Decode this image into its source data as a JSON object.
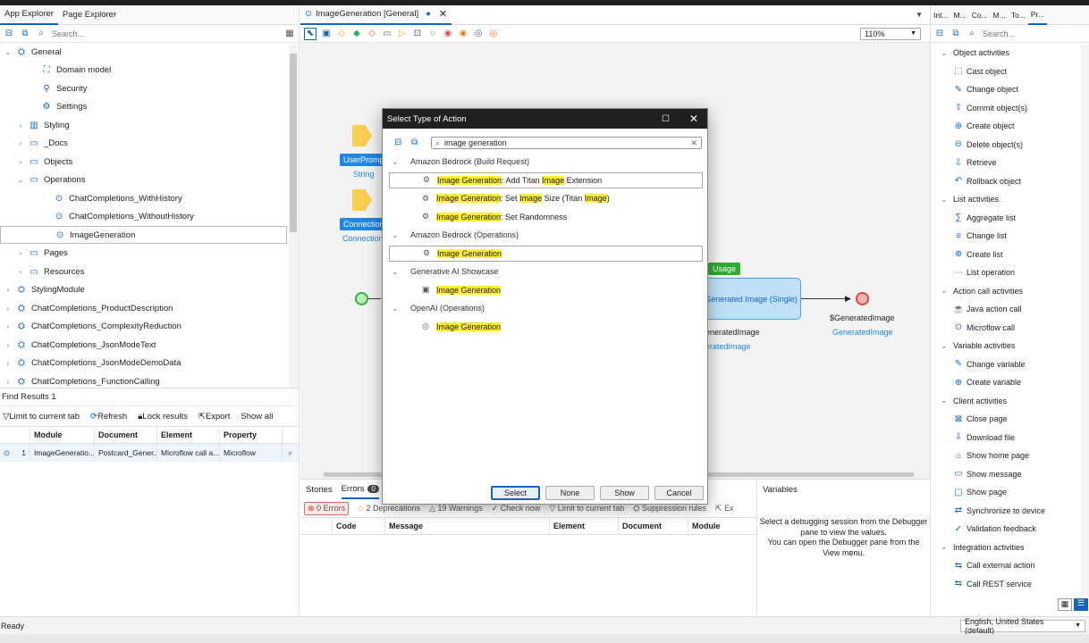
{
  "left_tabs": [
    "App Explorer",
    "Page Explorer"
  ],
  "search_placeholder": "Search...",
  "tree": [
    {
      "label": "General",
      "chev": "v",
      "icon": "module-icon",
      "indent": 0
    },
    {
      "label": "Domain model",
      "chev": "",
      "icon": "domain-model-icon",
      "indent": 2
    },
    {
      "label": "Security",
      "chev": "",
      "icon": "security-icon",
      "indent": 2
    },
    {
      "label": "Settings",
      "chev": "",
      "icon": "settings-icon",
      "indent": 2
    },
    {
      "label": "Styling",
      "chev": ">",
      "icon": "styling-icon",
      "indent": 1
    },
    {
      "label": "_Docs",
      "chev": ">",
      "icon": "folder-icon",
      "indent": 1
    },
    {
      "label": "Objects",
      "chev": ">",
      "icon": "folder-icon",
      "indent": 1
    },
    {
      "label": "Operations",
      "chev": "v",
      "icon": "folder-icon",
      "indent": 1
    },
    {
      "label": "ChatCompletions_WithHistory",
      "chev": "",
      "icon": "microflow-icon",
      "indent": 3
    },
    {
      "label": "ChatCompletions_WithoutHistory",
      "chev": "",
      "icon": "microflow-icon",
      "indent": 3
    },
    {
      "label": "ImageGeneration",
      "chev": "",
      "icon": "microflow-icon",
      "indent": 3
    },
    {
      "label": "Pages",
      "chev": ">",
      "icon": "folder-icon",
      "indent": 1
    },
    {
      "label": "Resources",
      "chev": ">",
      "icon": "folder-icon",
      "indent": 1
    },
    {
      "label": "StylingModule",
      "chev": ">",
      "icon": "module-icon",
      "indent": 0
    },
    {
      "label": "ChatCompletions_ProductDescription",
      "chev": ">",
      "icon": "module-icon",
      "indent": 0
    },
    {
      "label": "ChatCompletions_ComplexityReduction",
      "chev": ">",
      "icon": "module-icon",
      "indent": 0
    },
    {
      "label": "ChatCompletions_JsonModeText",
      "chev": ">",
      "icon": "module-icon",
      "indent": 0
    },
    {
      "label": "ChatCompletions_JsonModeDemoData",
      "chev": ">",
      "icon": "module-icon",
      "indent": 0
    },
    {
      "label": "ChatCompletions_FunctionCalling",
      "chev": ">",
      "icon": "module-icon",
      "indent": 0
    }
  ],
  "find": {
    "title": "Find Results 1",
    "tools": [
      "Limit to current tab",
      "Refresh",
      "Lock results",
      "Export",
      "Show all"
    ],
    "columns": [
      "Module",
      "Document",
      "Element",
      "Property"
    ],
    "row": {
      "num": "1",
      "module": "ImageGeneratio...",
      "document": "Postcard_Gener...",
      "element": "Microflow call a...",
      "property": "Microflow"
    }
  },
  "editor": {
    "tab_label": "ImageGeneration [General]",
    "zoom": "110%",
    "nodes": {
      "user_prompt_label": "UserPromp",
      "user_prompt_type": "String",
      "connection_label": "Connection",
      "connection_type": "Connection",
      "usage_badge": "Usage",
      "generated_single": "Generated Image (Single)",
      "generated_var_partial": "eneratedImage",
      "generated_type_partial": "eratedImage",
      "generated_var": "$GeneratedImage",
      "generated_type": "GeneratedImage"
    }
  },
  "dialog": {
    "title": "Select Type of Action",
    "search_value": "image generation",
    "groups": [
      {
        "label": "Amazon Bedrock (Build Request)",
        "items": [
          {
            "parts": [
              [
                "Image Generation",
                true
              ],
              [
                ": Add Titan ",
                false
              ],
              [
                "Image",
                true
              ],
              [
                " Extension",
                false
              ]
            ],
            "bordered": true
          },
          {
            "parts": [
              [
                "Image Generation",
                true
              ],
              [
                ": Set ",
                false
              ],
              [
                "Image",
                true
              ],
              [
                " Size (Titan ",
                false
              ],
              [
                "Image",
                true
              ],
              [
                ")",
                false
              ]
            ],
            "bordered": false
          },
          {
            "parts": [
              [
                "Image Generation",
                true
              ],
              [
                ": Set Randomness",
                false
              ]
            ],
            "bordered": false
          }
        ]
      },
      {
        "label": "Amazon Bedrock (Operations)",
        "items": [
          {
            "parts": [
              [
                "Image Generation",
                true
              ]
            ],
            "bordered": true
          }
        ]
      },
      {
        "label": "Generative AI Showcase",
        "items": [
          {
            "parts": [
              [
                "Image Generation",
                true
              ]
            ],
            "bordered": false
          }
        ]
      },
      {
        "label": "OpenAI (Operations)",
        "items": [
          {
            "parts": [
              [
                "Image Generation",
                true
              ]
            ],
            "bordered": false
          }
        ]
      }
    ],
    "buttons": {
      "select": "Select",
      "none": "None",
      "show": "Show",
      "cancel": "Cancel"
    }
  },
  "errors": {
    "tabs": [
      "Stories",
      "Errors"
    ],
    "error_count_badge": "0",
    "filters": [
      "0 Errors",
      "2 Deprecations",
      "19 Warnings",
      "Check now",
      "Limit to current tab",
      "Suppression rules",
      "Ex"
    ],
    "columns": [
      "Code",
      "Message",
      "Element",
      "Document",
      "Module"
    ]
  },
  "variables": {
    "title": "Variables",
    "message": "Select a debugging session from the Debugger pane to view the values.\nYou can open the Debugger pane from the View menu."
  },
  "toolbox": {
    "tabs": [
      "Int...",
      "M...",
      "Co...",
      "M...",
      "To...",
      "Pr..."
    ],
    "sections": [
      {
        "title": "Object activities",
        "items": [
          "Cast object",
          "Change object",
          "Commit object(s)",
          "Create object",
          "Delete object(s)",
          "Retrieve",
          "Rollback object"
        ]
      },
      {
        "title": "List activities",
        "items": [
          "Aggregate list",
          "Change list",
          "Create list",
          "List operation"
        ]
      },
      {
        "title": "Action call activities",
        "items": [
          "Java action call",
          "Microflow call"
        ]
      },
      {
        "title": "Variable activities",
        "items": [
          "Change variable",
          "Create variable"
        ]
      },
      {
        "title": "Client activities",
        "items": [
          "Close page",
          "Download file",
          "Show home page",
          "Show message",
          "Show page",
          "Synchronize to device",
          "Validation feedback"
        ]
      },
      {
        "title": "Integration activities",
        "items": [
          "Call external action",
          "Call REST service"
        ]
      }
    ]
  },
  "status": {
    "left": "Ready",
    "language": "English, United States (default)"
  }
}
